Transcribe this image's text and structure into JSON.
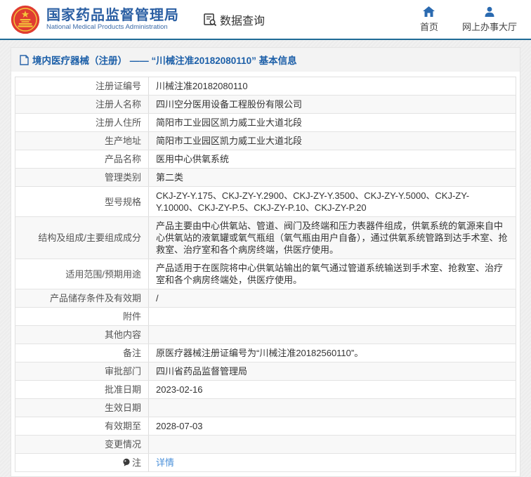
{
  "header": {
    "agency_name_cn": "国家药品监督管理局",
    "agency_name_en": "National Medical Products Administration",
    "data_query_label": "数据查询",
    "home_label": "首页",
    "service_hall_label": "网上办事大厅"
  },
  "breadcrumb": {
    "text": "境内医疗器械（注册） —— “川械注准20182080110” 基本信息"
  },
  "detail_table": {
    "rows": [
      {
        "label": "注册证编号",
        "value": "川械注准20182080110"
      },
      {
        "label": "注册人名称",
        "value": "四川空分医用设备工程股份有限公司"
      },
      {
        "label": "注册人住所",
        "value": "简阳市工业园区凯力威工业大道北段"
      },
      {
        "label": "生产地址",
        "value": "简阳市工业园区凯力威工业大道北段"
      },
      {
        "label": "产品名称",
        "value": "医用中心供氧系统"
      },
      {
        "label": "管理类别",
        "value": "第二类"
      },
      {
        "label": "型号规格",
        "value": "CKJ-ZY-Y.175、CKJ-ZY-Y.2900、CKJ-ZY-Y.3500、CKJ-ZY-Y.5000、CKJ-ZY-Y.10000、CKJ-ZY-P.5、CKJ-ZY-P.10、CKJ-ZY-P.20"
      },
      {
        "label": "结构及组成/主要组成成分",
        "value": "产品主要由中心供氧站、管道、阀门及终端和压力表器件组成，供氧系统的氧源来自中心供氧站的液氧罐或氧气瓶组（氧气瓶由用户自备），通过供氧系统管路到达手术室、抢救室、治疗室和各个病房终端，供医疗使用。"
      },
      {
        "label": "适用范围/预期用途",
        "value": "产品适用于在医院将中心供氧站输出的氧气通过管道系统输送到手术室、抢救室、治疗室和各个病房终端处，供医疗使用。"
      },
      {
        "label": "产品储存条件及有效期",
        "value": "/"
      },
      {
        "label": "附件",
        "value": ""
      },
      {
        "label": "其他内容",
        "value": ""
      },
      {
        "label": "备注",
        "value": "原医疗器械注册证编号为“川械注准20182560110”。"
      },
      {
        "label": "审批部门",
        "value": "四川省药品监督管理局"
      },
      {
        "label": "批准日期",
        "value": "2023-02-16"
      },
      {
        "label": "生效日期",
        "value": ""
      },
      {
        "label": "有效期至",
        "value": "2028-07-03"
      },
      {
        "label": "变更情况",
        "value": ""
      },
      {
        "label": "注",
        "value": "详情",
        "label_icon": "note-icon",
        "value_is_link": true
      }
    ]
  },
  "colors": {
    "accent_blue": "#2b5fa3",
    "header_rule": "#1f6b96",
    "link_blue": "#4a90d9",
    "alt_row_bg": "#f8f8f8",
    "emblem_red": "#e03c31",
    "emblem_gold": "#f3c63a"
  }
}
